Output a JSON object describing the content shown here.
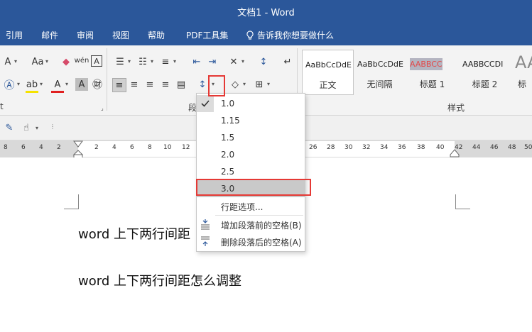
{
  "window": {
    "title": "文档1  -  Word"
  },
  "menu": {
    "tabs": [
      "引用",
      "邮件",
      "审阅",
      "视图",
      "帮助",
      "PDF工具集"
    ],
    "tell_me": "告诉我你想要做什么"
  },
  "ribbon": {
    "group_paragraph_label": "段",
    "group_styles_label": "样式",
    "styles": [
      {
        "sample": "AaBbCcDdE",
        "name": "正文"
      },
      {
        "sample": "AaBbCcDdE",
        "name": "无间隔"
      },
      {
        "sample": "AABBCC",
        "name": "标题 1"
      },
      {
        "sample": "AABBCCDI",
        "name": "标题 2"
      },
      {
        "sample": "AA",
        "name": "标"
      }
    ]
  },
  "ruler": {
    "ticks": [
      "8",
      "6",
      "4",
      "2",
      "2",
      "4",
      "6",
      "8",
      "10",
      "12",
      "26",
      "28",
      "30",
      "32",
      "34",
      "36",
      "38",
      "40",
      "42",
      "44",
      "46",
      "48",
      "50"
    ]
  },
  "line_spacing_menu": {
    "options": [
      "1.0",
      "1.15",
      "1.5",
      "2.0",
      "2.5",
      "3.0"
    ],
    "checked": "1.0",
    "highlighted": "3.0",
    "line_spacing_options": "行距选项...",
    "add_space_before": "增加段落前的空格(B)",
    "remove_space_after": "删除段落后的空格(A)"
  },
  "document": {
    "paragraphs": [
      "word 上下两行间距",
      "word 上下两行间距怎么调整"
    ]
  },
  "colors": {
    "accent": "#2b579a",
    "highlight": "#e53935"
  }
}
